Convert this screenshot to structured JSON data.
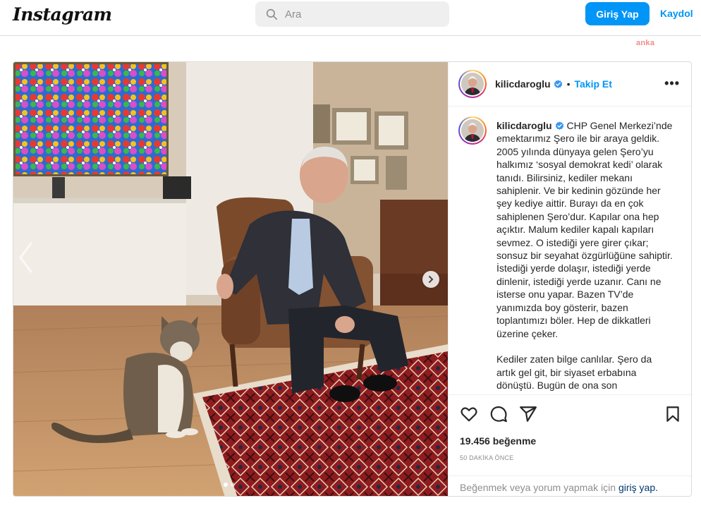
{
  "header": {
    "logo": "Instagram",
    "search_placeholder": "Ara",
    "login_label": "Giriş Yap",
    "signup_label": "Kaydol"
  },
  "watermark": "anka",
  "post": {
    "username": "kilicdaroglu",
    "separator": "•",
    "follow_label": "Takip Et",
    "more_label": "•••",
    "caption_username": "kilicdaroglu",
    "caption_text": " CHP Genel Merkezi’nde emektarımız Şero ile bir araya geldik. 2005 yılında dünyaya gelen Şero’yu halkımız ‘sosyal demokrat kedi’ olarak tanıdı. Bilirsiniz, kediler mekanı sahiplenir. Ve bir kedinin gözünde her şey kediye aittir. Burayı da en çok sahiplenen Şero’dur. Kapılar ona hep açıktır. Malum kediler kapalı kapıları sevmez. O istediği yere girer çıkar; sonsuz bir seyahat özgürlüğüne sahiptir. İstediği yerde dolaşır, istediği yerde dinlenir, istediği yerde uzanır. Canı ne isterse onu yapar. Bazen TV’de yanımızda boy gösterir, bazen toplantımızı böler. Hep de dikkatleri üzerine çeker.\n\nKediler zaten bilge canlılar. Şero da artık gel git, bir siyaset erbabına dönüştü. Bugün de ona son",
    "likes": "19.456 beğenme",
    "time": "50 DAKİKA ÖNCE",
    "login_prompt": "Beğenmek veya yorum yapmak için",
    "login_link": "giriş yap."
  },
  "icons": {
    "like": "heart-icon",
    "comment": "comment-icon",
    "share": "share-icon",
    "save": "bookmark-icon",
    "search": "search-icon",
    "verified": "verified-badge-icon"
  },
  "colors": {
    "brand_blue": "#0095f6",
    "link_dark": "#00376b",
    "muted": "#8e8e8e"
  }
}
